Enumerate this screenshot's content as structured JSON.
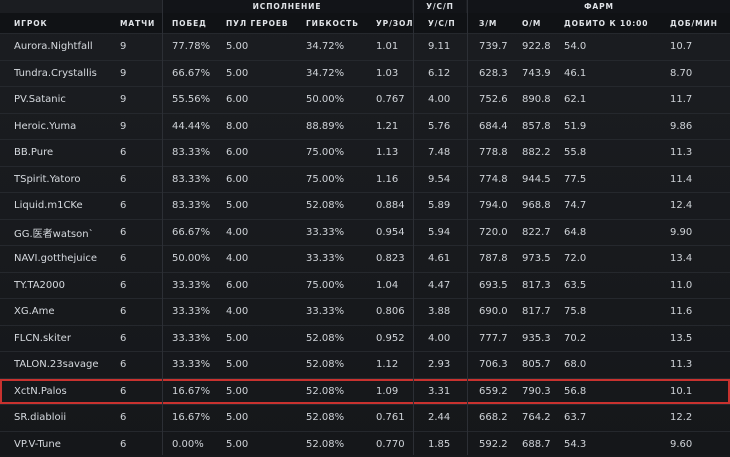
{
  "header": {
    "group_performance": "ИСПОЛНЕНИЕ",
    "group_ksp": "У/С/П",
    "group_farm": "ФАРМ",
    "columns": {
      "player": "ИГРОК",
      "matches": "МАТЧИ",
      "wins": "ПОБЕД",
      "hero_pool": "ПУЛ ГЕРОЕВ",
      "flexibility": "ГИБКОСТЬ",
      "dmg_gold": "УР/ЗОЛ",
      "kda": "У/С/П",
      "gpm": "З/М",
      "xpm": "О/М",
      "lh10": "ДОБИТО К 10:00",
      "lhpm": "ДОБ/МИН"
    }
  },
  "rows": [
    {
      "player": "Aurora.Nightfall",
      "matches": "9",
      "wins": "77.78%",
      "hero_pool": "5.00",
      "flexibility": "34.72%",
      "dmg_gold": "1.01",
      "kda": "9.11",
      "gpm": "739.7",
      "xpm": "922.8",
      "lh10": "54.0",
      "lhpm": "10.7"
    },
    {
      "player": "Tundra.Crystallis",
      "matches": "9",
      "wins": "66.67%",
      "hero_pool": "5.00",
      "flexibility": "34.72%",
      "dmg_gold": "1.03",
      "kda": "6.12",
      "gpm": "628.3",
      "xpm": "743.9",
      "lh10": "46.1",
      "lhpm": "8.70"
    },
    {
      "player": "PV.Satanic",
      "matches": "9",
      "wins": "55.56%",
      "hero_pool": "6.00",
      "flexibility": "50.00%",
      "dmg_gold": "0.767",
      "kda": "4.00",
      "gpm": "752.6",
      "xpm": "890.8",
      "lh10": "62.1",
      "lhpm": "11.7"
    },
    {
      "player": "Heroic.Yuma",
      "matches": "9",
      "wins": "44.44%",
      "hero_pool": "8.00",
      "flexibility": "88.89%",
      "dmg_gold": "1.21",
      "kda": "5.76",
      "gpm": "684.4",
      "xpm": "857.8",
      "lh10": "51.9",
      "lhpm": "9.86"
    },
    {
      "player": "BB.Pure",
      "matches": "6",
      "wins": "83.33%",
      "hero_pool": "6.00",
      "flexibility": "75.00%",
      "dmg_gold": "1.13",
      "kda": "7.48",
      "gpm": "778.8",
      "xpm": "882.2",
      "lh10": "55.8",
      "lhpm": "11.3"
    },
    {
      "player": "TSpirit.Yatoro",
      "matches": "6",
      "wins": "83.33%",
      "hero_pool": "6.00",
      "flexibility": "75.00%",
      "dmg_gold": "1.16",
      "kda": "9.54",
      "gpm": "774.8",
      "xpm": "944.5",
      "lh10": "77.5",
      "lhpm": "11.4"
    },
    {
      "player": "Liquid.m1CKe",
      "matches": "6",
      "wins": "83.33%",
      "hero_pool": "5.00",
      "flexibility": "52.08%",
      "dmg_gold": "0.884",
      "kda": "5.89",
      "gpm": "794.0",
      "xpm": "968.8",
      "lh10": "74.7",
      "lhpm": "12.4"
    },
    {
      "player": "GG.医者watson`",
      "matches": "6",
      "wins": "66.67%",
      "hero_pool": "4.00",
      "flexibility": "33.33%",
      "dmg_gold": "0.954",
      "kda": "5.94",
      "gpm": "720.0",
      "xpm": "822.7",
      "lh10": "64.8",
      "lhpm": "9.90"
    },
    {
      "player": "NAVI.gotthejuice",
      "matches": "6",
      "wins": "50.00%",
      "hero_pool": "4.00",
      "flexibility": "33.33%",
      "dmg_gold": "0.823",
      "kda": "4.61",
      "gpm": "787.8",
      "xpm": "973.5",
      "lh10": "72.0",
      "lhpm": "13.4"
    },
    {
      "player": "TY.TA2000",
      "matches": "6",
      "wins": "33.33%",
      "hero_pool": "6.00",
      "flexibility": "75.00%",
      "dmg_gold": "1.04",
      "kda": "4.47",
      "gpm": "693.5",
      "xpm": "817.3",
      "lh10": "63.5",
      "lhpm": "11.0"
    },
    {
      "player": "XG.Ame",
      "matches": "6",
      "wins": "33.33%",
      "hero_pool": "4.00",
      "flexibility": "33.33%",
      "dmg_gold": "0.806",
      "kda": "3.88",
      "gpm": "690.0",
      "xpm": "817.7",
      "lh10": "75.8",
      "lhpm": "11.6"
    },
    {
      "player": "FLCN.skiter",
      "matches": "6",
      "wins": "33.33%",
      "hero_pool": "5.00",
      "flexibility": "52.08%",
      "dmg_gold": "0.952",
      "kda": "4.00",
      "gpm": "777.7",
      "xpm": "935.3",
      "lh10": "70.2",
      "lhpm": "13.5"
    },
    {
      "player": "TALON.23savage",
      "matches": "6",
      "wins": "33.33%",
      "hero_pool": "5.00",
      "flexibility": "52.08%",
      "dmg_gold": "1.12",
      "kda": "2.93",
      "gpm": "706.3",
      "xpm": "805.7",
      "lh10": "68.0",
      "lhpm": "11.3"
    },
    {
      "player": "XctN.Palos",
      "matches": "6",
      "wins": "16.67%",
      "hero_pool": "5.00",
      "flexibility": "52.08%",
      "dmg_gold": "1.09",
      "kda": "3.31",
      "gpm": "659.2",
      "xpm": "790.3",
      "lh10": "56.8",
      "lhpm": "10.1",
      "highlighted": true
    },
    {
      "player": "SR.diabloii",
      "matches": "6",
      "wins": "16.67%",
      "hero_pool": "5.00",
      "flexibility": "52.08%",
      "dmg_gold": "0.761",
      "kda": "2.44",
      "gpm": "668.2",
      "xpm": "764.2",
      "lh10": "63.7",
      "lhpm": "12.2"
    },
    {
      "player": "VP.V-Tune",
      "matches": "6",
      "wins": "0.00%",
      "hero_pool": "5.00",
      "flexibility": "52.08%",
      "dmg_gold": "0.770",
      "kda": "1.85",
      "gpm": "592.2",
      "xpm": "688.7",
      "lh10": "54.3",
      "lhpm": "9.60"
    }
  ],
  "colors": {
    "highlight_border": "#c8322f",
    "background": "#17191c",
    "text": "#cfd3d8"
  }
}
